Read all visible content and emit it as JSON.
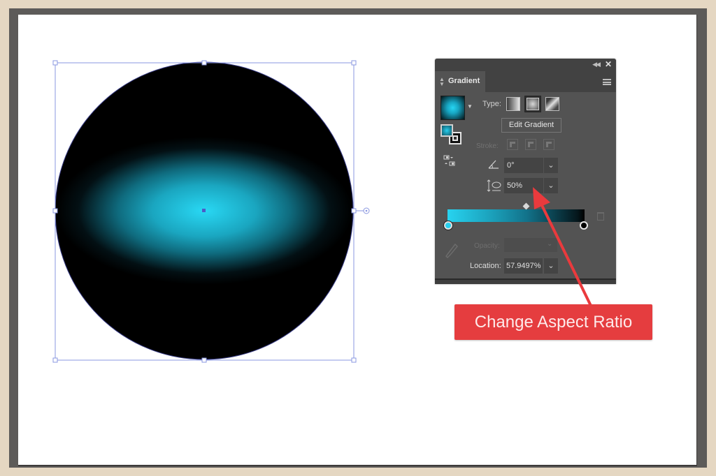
{
  "colors": {
    "background_outer": "#e5d7c2",
    "frame": "#5d5b59",
    "canvas": "#ffffff",
    "selection": "#7f8fe0",
    "gradient_start": "#27d3f0",
    "gradient_end": "#000000",
    "panel_bg": "#535353",
    "callout": "#e53d3f"
  },
  "artboard": {
    "object": {
      "shape": "circle",
      "fill": "radial-gradient",
      "selected": true
    }
  },
  "gradient_panel": {
    "collapse_icon": "double-chevron-left",
    "close_icon": "close-x",
    "tab_label": "Gradient",
    "menu_icon": "hamburger-menu",
    "type_label": "Type:",
    "types": [
      {
        "name": "linear",
        "selected": false
      },
      {
        "name": "radial",
        "selected": true
      },
      {
        "name": "freeform",
        "selected": false
      }
    ],
    "edit_gradient_label": "Edit Gradient",
    "stroke_label": "Stroke:",
    "angle_value": "0°",
    "aspect_ratio_value": "50%",
    "gradient_stops": [
      {
        "color": "#27d3f0",
        "position": 0
      },
      {
        "color": "#000000",
        "position": 100
      }
    ],
    "midpoint_position_percent": 57.9497,
    "opacity_label": "Opacity:",
    "location_label": "Location:",
    "location_value": "57.9497%"
  },
  "callout": {
    "text": "Change Aspect Ratio",
    "points_to": "aspect-ratio-field"
  }
}
